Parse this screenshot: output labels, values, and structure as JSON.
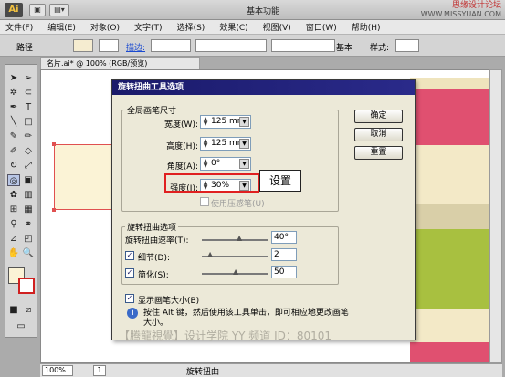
{
  "window": {
    "app_logo": "Ai",
    "workspace": "基本功能",
    "watermark_top": "思缘设计论坛",
    "watermark_url": "WWW.MISSYUAN.COM"
  },
  "menu": [
    "文件(F)",
    "编辑(E)",
    "对象(O)",
    "文字(T)",
    "选择(S)",
    "效果(C)",
    "视图(V)",
    "窗口(W)",
    "帮助(H)"
  ],
  "control": {
    "path_label": "路径",
    "stroke_label": "描边:",
    "basic_label": "基本",
    "style_label": "样式:"
  },
  "doc_tab": "名片.ai* @ 100% (RGB/预览)",
  "status": {
    "zoom": "100%",
    "page": "1",
    "tool_name": "旋转扭曲"
  },
  "dialog": {
    "title": "旋转扭曲工具选项",
    "global_group": "全局画笔尺寸",
    "width_label": "宽度(W):",
    "width_value": "125 mm",
    "height_label": "高度(H):",
    "height_value": "125 mm",
    "angle_label": "角度(A):",
    "angle_value": "0°",
    "intensity_label": "强度(I):",
    "intensity_value": "30%",
    "pressure_label": "使用压感笔(U)",
    "twirl_group": "旋转扭曲选项",
    "twirl_rate_label": "旋转扭曲速率(T):",
    "twirl_rate_value": "40°",
    "detail_label": "细节(D):",
    "detail_value": "2",
    "simplify_label": "简化(S):",
    "simplify_value": "50",
    "show_brush_label": "显示画笔大小(B)",
    "info_text": "按住 Alt 键，然后使用该工具单击，即可相应地更改画笔大小。",
    "ok": "确定",
    "cancel": "取消",
    "reset": "重置"
  },
  "callout": "设置",
  "bottom_watermark": "【腾龍視覺】设计学院  YY 频道 ID：80101",
  "colors": {
    "dialog_bg": "#ece9d8",
    "title_bar": "#1a1a6a",
    "highlight": "#e02020",
    "art_pink": "#e05070",
    "art_green": "#a8c040",
    "art_cream": "#f3e9c7"
  }
}
